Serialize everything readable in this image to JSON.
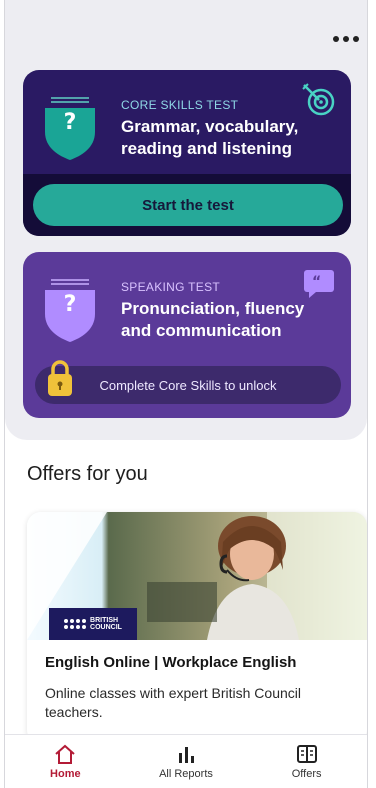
{
  "header": {
    "more_menu_icon": "more-horizontal-icon"
  },
  "core_test": {
    "kicker": "CORE SKILLS TEST",
    "title": "Grammar, vocabulary, reading and listening",
    "badge_symbol": "?",
    "badge_color": "#1aa596",
    "corner_icon": "target-icon",
    "button_label": "Start the test"
  },
  "speaking_test": {
    "kicker": "SPEAKING TEST",
    "title": "Pronunciation, fluency and communication",
    "badge_symbol": "?",
    "badge_color": "#b08cff",
    "corner_icon": "speech-bubble-icon",
    "lock_label": "Complete Core Skills to unlock"
  },
  "offers": {
    "section_title": "Offers for you",
    "items": [
      {
        "brand_line1": "BRITISH",
        "brand_line2": "COUNCIL",
        "heading": "English Online | Workplace English",
        "description": "Online classes with expert British Council teachers."
      }
    ]
  },
  "nav": {
    "items": [
      {
        "label": "Home",
        "icon": "home-icon",
        "active": true
      },
      {
        "label": "All Reports",
        "icon": "bar-chart-icon",
        "active": false
      },
      {
        "label": "Offers",
        "icon": "offers-book-icon",
        "active": false
      }
    ]
  },
  "colors": {
    "core_card": "#2a1a63",
    "speaking_card": "#5b3a99",
    "accent_teal": "#26a999",
    "active_nav": "#b31b36"
  }
}
